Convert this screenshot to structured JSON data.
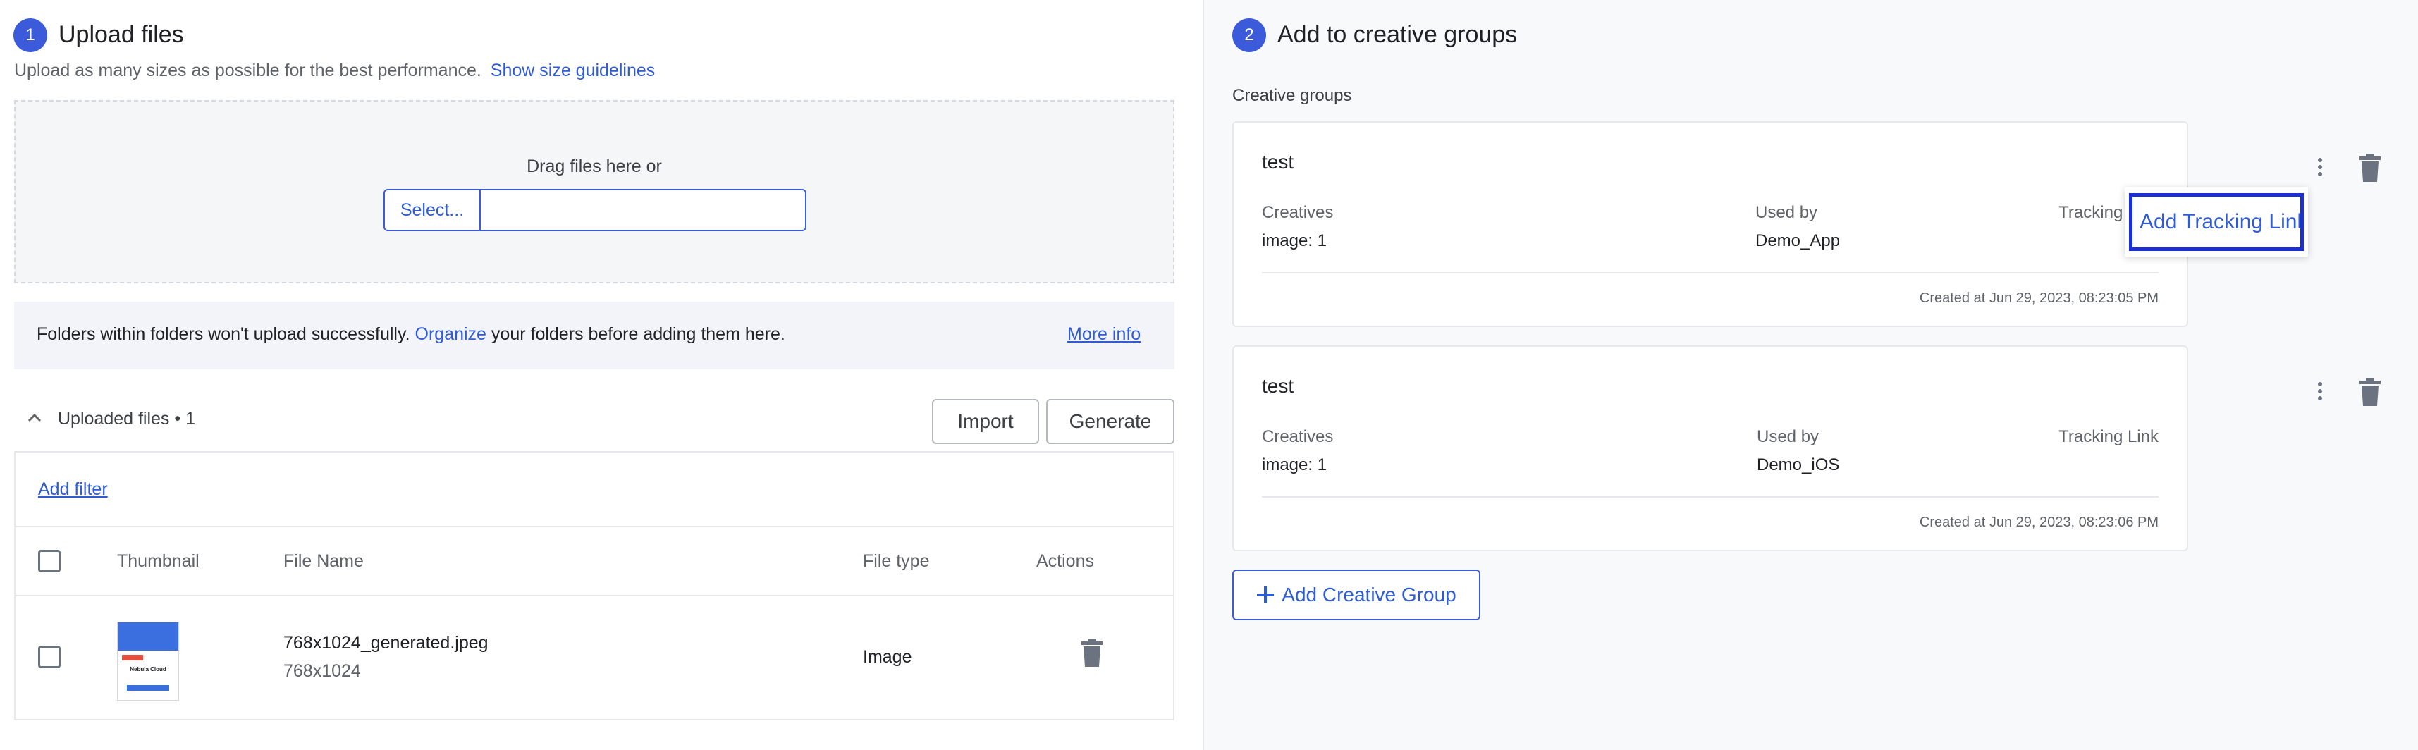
{
  "left": {
    "step_number": "1",
    "title": "Upload files",
    "subtitle": "Upload as many sizes as possible for the best performance.",
    "size_guidelines_link": "Show size guidelines",
    "dropzone": {
      "text": "Drag files here or",
      "select_button": "Select...",
      "file_input_value": ""
    },
    "notice": {
      "text_before": "Folders within folders won't upload successfully.",
      "organize_link": "Organize",
      "text_after": "your folders before adding them here.",
      "more_info_link": "More info"
    },
    "uploaded": {
      "label": "Uploaded files • 1",
      "import_button": "Import",
      "generate_button": "Generate"
    },
    "table": {
      "add_filter": "Add filter",
      "columns": [
        "Thumbnail",
        "File Name",
        "File type",
        "Actions"
      ],
      "rows": [
        {
          "file_name": "768x1024_generated.jpeg",
          "dimensions": "768x1024",
          "file_type": "Image"
        }
      ]
    }
  },
  "right": {
    "step_number": "2",
    "title": "Add to creative groups",
    "section_label": "Creative groups",
    "groups": [
      {
        "name": "test",
        "creatives_label": "Creatives",
        "creatives_value": "image: 1",
        "used_by_label": "Used by",
        "used_by_value": "Demo_App",
        "tracking_label": "Tracking Link",
        "created_at": "Created at Jun 29, 2023, 08:23:05 PM"
      },
      {
        "name": "test",
        "creatives_label": "Creatives",
        "creatives_value": "image: 1",
        "used_by_label": "Used by",
        "used_by_value": "Demo_iOS",
        "tracking_label": "Tracking Link",
        "created_at": "Created at Jun 29, 2023, 08:23:06 PM"
      }
    ],
    "popup_add_tracking_link": "Add Tracking Link",
    "add_group_button": "Add Creative Group"
  },
  "thumbnail_text": {
    "heading": "Nebula Cloud"
  },
  "colors": {
    "accent": "#3b5bdb",
    "link": "#2f5bd3",
    "highlight_border": "#1a2fd6",
    "right_panel_bg": "#f8f9fb"
  }
}
